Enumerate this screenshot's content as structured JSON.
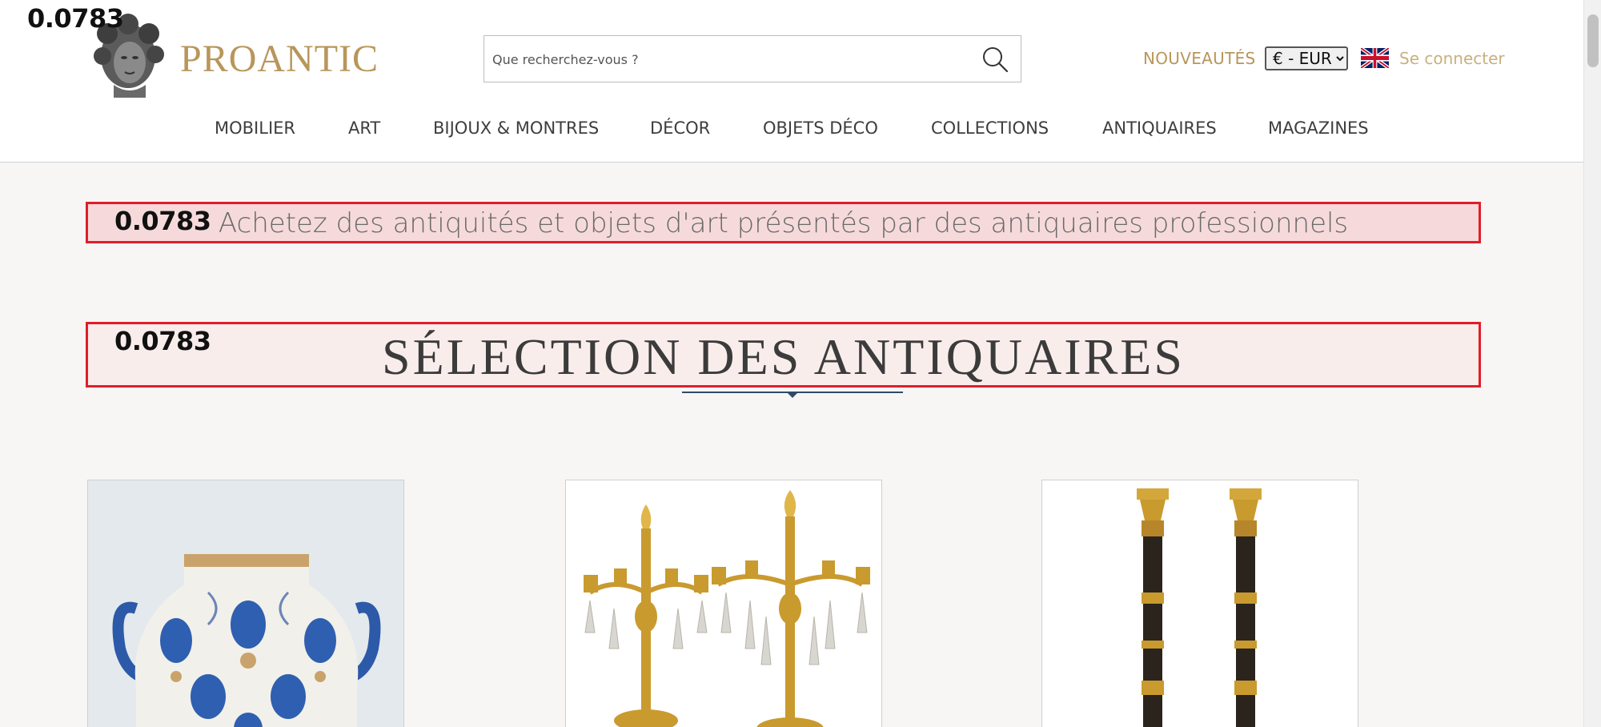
{
  "overlay": {
    "score_label": "0.0783"
  },
  "header": {
    "logo_text": "PROANTIC",
    "search": {
      "placeholder": "Que recherchez-vous ?"
    },
    "new_link": "NOUVEAUTÉS",
    "currency_selected": "€ - EUR",
    "login": "Se connecter",
    "language_icon": "uk-flag-icon"
  },
  "nav": {
    "items": [
      {
        "label": "MOBILIER"
      },
      {
        "label": "ART"
      },
      {
        "label": "BIJOUX & MONTRES"
      },
      {
        "label": "DÉCOR"
      },
      {
        "label": "OBJETS DÉCO"
      },
      {
        "label": "COLLECTIONS"
      },
      {
        "label": "ANTIQUAIRES"
      },
      {
        "label": "MAGAZINES"
      }
    ]
  },
  "main": {
    "tagline": "Achetez des antiquités et objets d'art présentés par des antiquaires professionnels",
    "section_title": "SÉLECTION DES ANTIQUAIRES"
  },
  "colors": {
    "brand_gold": "#b8965a",
    "highlight_border": "#e11d2a",
    "navy_rule": "#2f4a6a"
  }
}
